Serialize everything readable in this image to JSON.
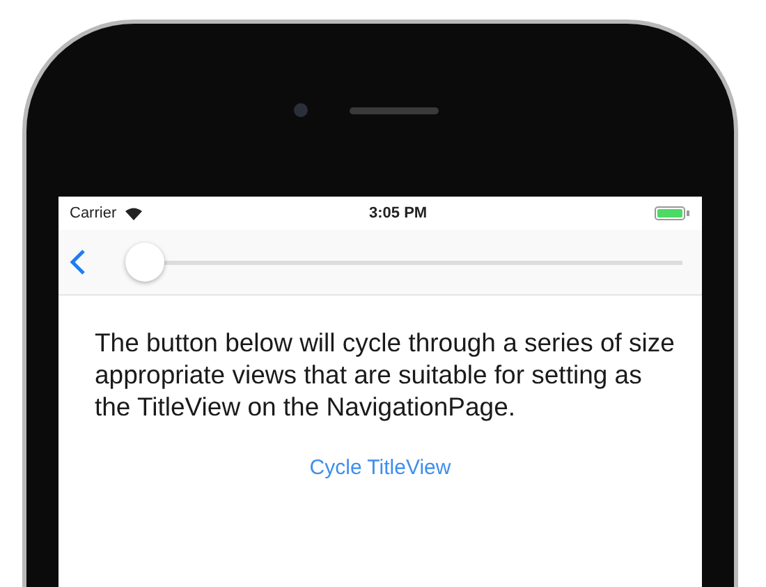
{
  "status_bar": {
    "carrier": "Carrier",
    "time": "3:05 PM"
  },
  "nav_bar": {
    "slider": {
      "level": 0
    }
  },
  "description": "The button below will cycle through a series of size appropriate views that are suitable for setting as the TitleView on the NavigationPage.",
  "button": {
    "label": "Cycle TitleView"
  }
}
